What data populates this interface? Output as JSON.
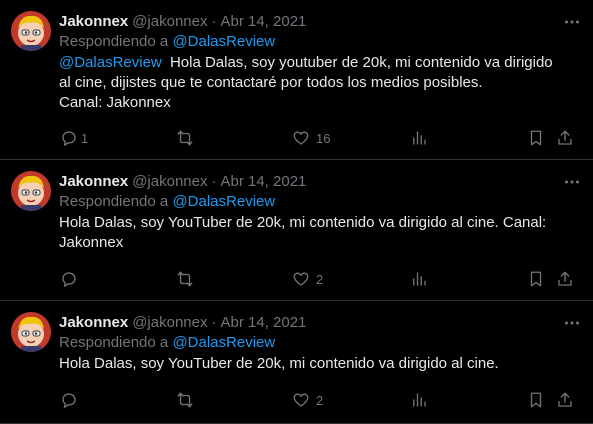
{
  "tweets": [
    {
      "name": "Jakonnex",
      "handle": "@jakonnex",
      "dot": "·",
      "date": "Abr 14, 2021",
      "reply_prefix": "Respondiendo a",
      "reply_to": "@DalasReview",
      "mention": "@DalasReview",
      "lines": [
        "Hola Dalas, soy youtuber de 20k, mi contenido va dirigido",
        "al cine, dijistes que te contactaré por todos los medios posibles.",
        "Canal: Jakonnex"
      ],
      "reply_count": "1",
      "like_count": "16"
    },
    {
      "name": "Jakonnex",
      "handle": "@jakonnex",
      "dot": "·",
      "date": "Abr 14, 2021",
      "reply_prefix": "Respondiendo a",
      "reply_to": "@DalasReview",
      "lines": [
        "Hola Dalas, soy YouTuber de 20k, mi contenido va dirigido al cine. Canal:",
        "Jakonnex"
      ],
      "reply_count": "",
      "like_count": "2"
    },
    {
      "name": "Jakonnex",
      "handle": "@jakonnex",
      "dot": "·",
      "date": "Abr 14, 2021",
      "reply_prefix": "Respondiendo a",
      "reply_to": "@DalasReview",
      "lines": [
        "Hola Dalas, soy YouTuber de 20k, mi contenido va dirigido al cine."
      ],
      "reply_count": "",
      "like_count": "2"
    }
  ],
  "icons": {
    "more": "more-icon",
    "reply": "reply-icon",
    "retweet": "retweet-icon",
    "like": "heart-icon",
    "views": "views-icon",
    "bookmark": "bookmark-icon",
    "share": "share-icon"
  },
  "colors": {
    "background": "#000000",
    "text": "#e7e9ea",
    "secondary": "#71767b",
    "link": "#1d9bf0",
    "divider": "#2f3336"
  }
}
